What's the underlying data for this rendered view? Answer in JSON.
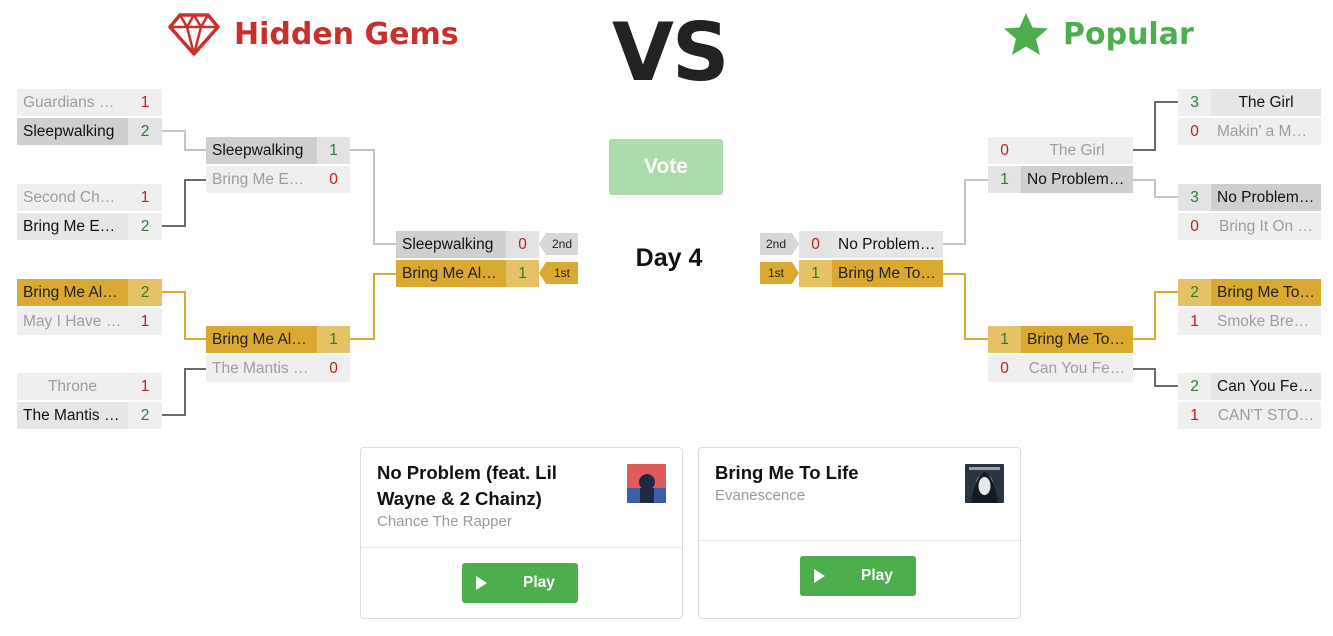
{
  "header": {
    "left_label": "Hidden Gems",
    "vs": "VS",
    "right_label": "Popular",
    "left_icon": "gem-icon",
    "right_icon": "star-icon",
    "colors": {
      "hidden_gems": "#c9302c",
      "popular": "#4cae4c",
      "winner": "#d9a931"
    }
  },
  "vote": {
    "label": "Vote"
  },
  "day": {
    "label": "Day 4"
  },
  "left": {
    "r1": [
      {
        "top": {
          "name": "Guardians o…",
          "score": "1"
        },
        "bottom": {
          "name": "Sleepwalking",
          "score": "2"
        }
      },
      {
        "top": {
          "name": "Second Cha…",
          "score": "1"
        },
        "bottom": {
          "name": "Bring Me Ed…",
          "score": "2"
        }
      },
      {
        "top": {
          "name": "Bring Me Al…",
          "score": "2"
        },
        "bottom": {
          "name": "May I Have …",
          "score": "1"
        }
      },
      {
        "top": {
          "name": "Throne",
          "score": "1"
        },
        "bottom": {
          "name": "The Mantis …",
          "score": "2"
        }
      }
    ],
    "r2": [
      {
        "top": {
          "name": "Sleepwalking",
          "score": "1"
        },
        "bottom": {
          "name": "Bring Me Ed…",
          "score": "0"
        }
      },
      {
        "top": {
          "name": "Bring Me Al…",
          "score": "1"
        },
        "bottom": {
          "name": "The Mantis …",
          "score": "0"
        }
      }
    ],
    "final": {
      "top": {
        "name": "Sleepwalking",
        "score": "0",
        "place": "2nd"
      },
      "bottom": {
        "name": "Bring Me Al…",
        "score": "1",
        "place": "1st"
      }
    }
  },
  "right": {
    "r1": [
      {
        "top": {
          "name": "The Girl",
          "score": "3"
        },
        "bottom": {
          "name": "Makin' a Move",
          "score": "0"
        }
      },
      {
        "top": {
          "name": "No Problem …",
          "score": "3"
        },
        "bottom": {
          "name": "Bring It On …",
          "score": "0"
        }
      },
      {
        "top": {
          "name": "Bring Me To …",
          "score": "2"
        },
        "bottom": {
          "name": "Smoke Brea…",
          "score": "1"
        }
      },
      {
        "top": {
          "name": "Can You Fe…",
          "score": "2"
        },
        "bottom": {
          "name": "CAN'T STO…",
          "score": "1"
        }
      }
    ],
    "r2": [
      {
        "top": {
          "name": "The Girl",
          "score": "0"
        },
        "bottom": {
          "name": "No Problem …",
          "score": "1"
        }
      },
      {
        "top": {
          "name": "Bring Me To …",
          "score": "1"
        },
        "bottom": {
          "name": "Can You Fe…",
          "score": "0"
        }
      }
    ],
    "final": {
      "top": {
        "name": "No Problem …",
        "score": "0",
        "place": "2nd"
      },
      "bottom": {
        "name": "Bring Me To …",
        "score": "1",
        "place": "1st"
      }
    }
  },
  "cards": [
    {
      "title": "No Problem (feat. Lil Wayne & 2 Chainz)",
      "artist": "Chance The Rapper",
      "play": "Play",
      "thumb": "album-art-icon"
    },
    {
      "title": "Bring Me To Life",
      "artist": "Evanescence",
      "play": "Play",
      "thumb": "album-art-icon"
    }
  ]
}
